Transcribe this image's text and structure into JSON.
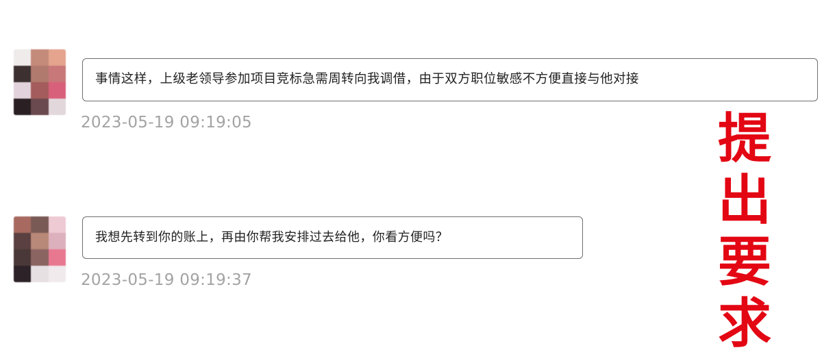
{
  "messages": [
    {
      "text": "事情这样，上级老领导参加项目竞标急需周转向我调借，由于双方职位敏感不方便直接与他对接",
      "timestamp": "2023-05-19 09:19:05",
      "avatar_colors": [
        "#f0ebeb",
        "#c48a7a",
        "#e4a48e",
        "#3c3030",
        "#b07a6e",
        "#c87878",
        "#e2d2dc",
        "#a45c5c",
        "#d8607a",
        "#2a2024",
        "#6a4a4e",
        "#e2d8dc"
      ]
    },
    {
      "text": "我想先转到你的账上，再由你帮我安排过去给他，你看方便吗？",
      "timestamp": "2023-05-19 09:19:37",
      "avatar_colors": [
        "#a86a60",
        "#7a5a54",
        "#eecad4",
        "#5a4040",
        "#b88878",
        "#dcb0bc",
        "#4a3838",
        "#8a6460",
        "#e87890",
        "#2c2228",
        "#e6e0e2",
        "#f0eaec"
      ]
    }
  ],
  "annotation": {
    "chars": [
      "提",
      "出",
      "要",
      "求"
    ],
    "color": "#e30613"
  },
  "colors": {
    "timestamp": "#a3a3a3",
    "bubble_border": "#6e6e6e"
  }
}
